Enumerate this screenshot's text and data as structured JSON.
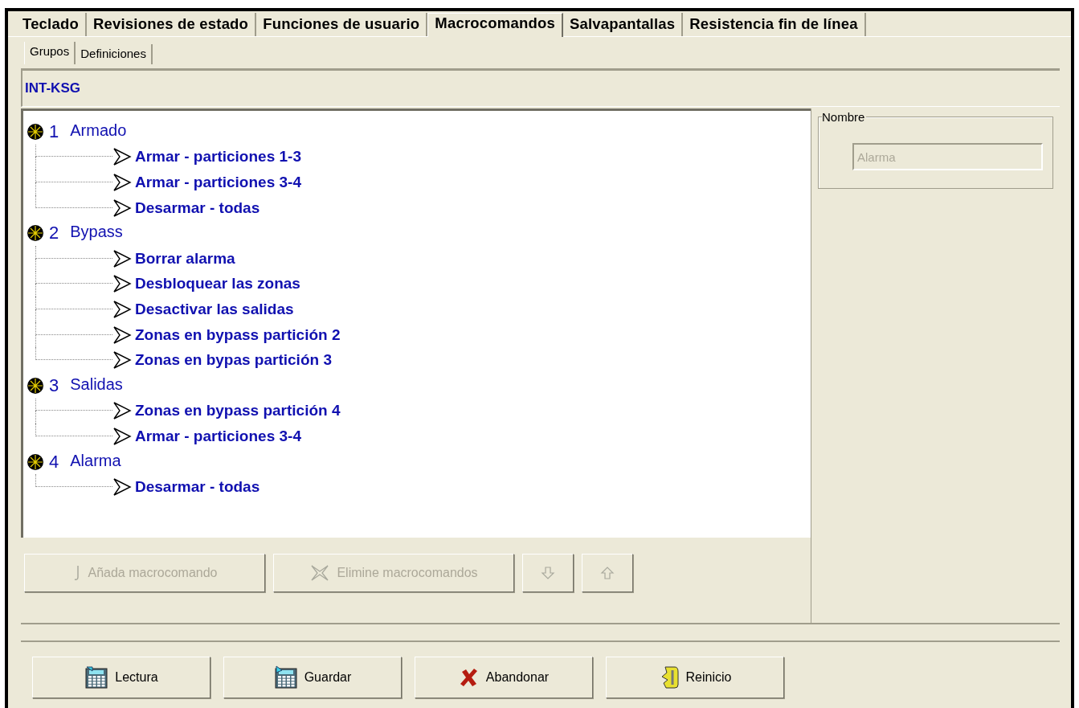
{
  "tabs": [
    {
      "label": "Teclado",
      "selected": false
    },
    {
      "label": "Revisiones de estado",
      "selected": false
    },
    {
      "label": "Funciones de usuario",
      "selected": false
    },
    {
      "label": "Macrocomandos",
      "selected": true
    },
    {
      "label": "Salvapantallas",
      "selected": false
    },
    {
      "label": "Resistencia fin de línea",
      "selected": false
    }
  ],
  "subtabs": [
    {
      "label": "Grupos",
      "selected": true
    },
    {
      "label": "Definiciones",
      "selected": false
    }
  ],
  "header": "INT-KSG",
  "groups": [
    {
      "number": "1",
      "name": "Armado",
      "children": [
        {
          "label": "Armar - particiones 1-3"
        },
        {
          "label": "Armar - particiones 3-4"
        },
        {
          "label": "Desarmar - todas"
        }
      ]
    },
    {
      "number": "2",
      "name": "Bypass",
      "children": [
        {
          "label": "Borrar alarma"
        },
        {
          "label": "Desbloquear las zonas"
        },
        {
          "label": "Desactivar las salidas"
        },
        {
          "label": "Zonas en bypass partición 2"
        },
        {
          "label": "Zonas en bypas partición 3"
        }
      ]
    },
    {
      "number": "3",
      "name": "Salidas",
      "children": [
        {
          "label": "Zonas en bypass partición 4"
        },
        {
          "label": "Armar - particiones 3-4"
        }
      ]
    },
    {
      "number": "4",
      "name": "Alarma",
      "children": [
        {
          "label": "Desarmar - todas"
        }
      ]
    }
  ],
  "name_box": {
    "label": "Nombre",
    "value": "Alarma",
    "disabled": true
  },
  "actions": [
    {
      "kind": "add",
      "label": "Añada macrocomando",
      "disabled": true
    },
    {
      "kind": "delete",
      "label": "Elimine macrocomandos",
      "disabled": true
    },
    {
      "kind": "down",
      "disabled": true
    },
    {
      "kind": "up",
      "disabled": true
    }
  ],
  "footer": [
    {
      "kind": "read",
      "label": "Lectura"
    },
    {
      "kind": "save",
      "label": "Guardar"
    },
    {
      "kind": "cancel",
      "label": "Abandonar"
    },
    {
      "kind": "reset",
      "label": "Reinicio"
    }
  ]
}
